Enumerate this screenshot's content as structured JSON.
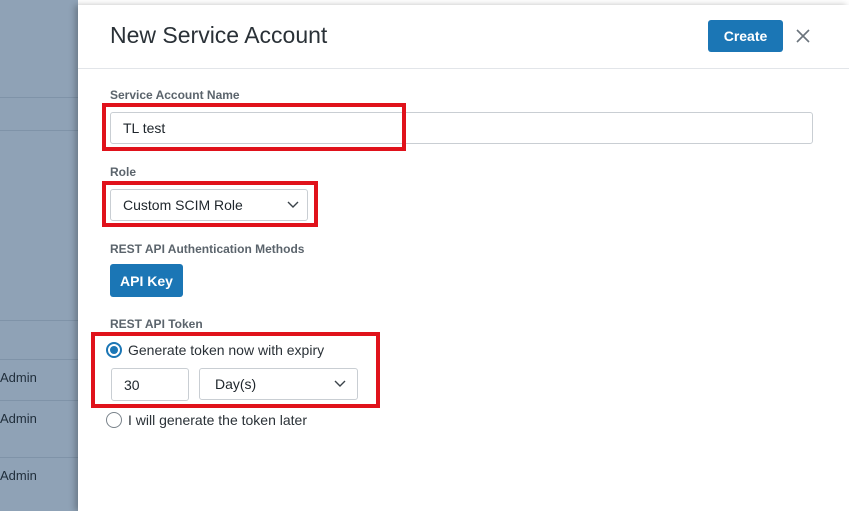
{
  "background": {
    "rows": [
      "Admin",
      "Admin",
      "Admin"
    ]
  },
  "modal": {
    "title": "New Service Account",
    "create_label": "Create",
    "close_glyph": "×"
  },
  "form": {
    "name_label": "Service Account Name",
    "name_value": "TL test",
    "role_label": "Role",
    "role_value": "Custom SCIM Role",
    "auth_label": "REST API Authentication Methods",
    "auth_button": "API Key",
    "token_label": "REST API Token",
    "token_options": [
      {
        "label": "Generate token now with expiry",
        "checked": true
      },
      {
        "label": "I will generate the token later",
        "checked": false
      }
    ],
    "expiry_value": "30",
    "expiry_unit": "Day(s)"
  },
  "colors": {
    "primary": "#1b76b5",
    "highlight": "#e0121b",
    "overlay": "#8fa2b6"
  },
  "icons": {
    "close": "close-icon",
    "dropdown": "chevron-down-icon"
  }
}
